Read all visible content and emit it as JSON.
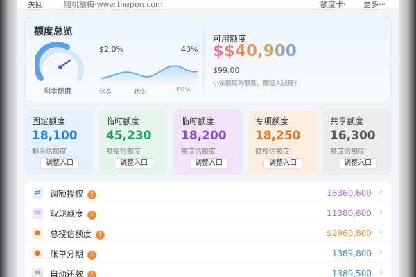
{
  "topbar": {
    "back_label": "关回",
    "site": "随机额梅·www.thepon.com",
    "right1": "额度卡·",
    "right2": "更多···"
  },
  "summary": {
    "title": "额度总览",
    "gauge_label": "剩余额度",
    "rate_left": "$2,0%",
    "rate_right": "40%",
    "axis": [
      "状态",
      "状态",
      "60%"
    ],
    "available": {
      "title": "可用额度",
      "amount": "$$40,900",
      "sub": "$99,00",
      "note": "小余额度刘额度，额提入回度亻"
    }
  },
  "tiles": [
    {
      "title": "固定额度",
      "value": "18,100",
      "sub": "剩余信额度",
      "button": "调整入口",
      "color": "#2b7fd6",
      "bg": "#e6f1fc"
    },
    {
      "title": "临时额度",
      "value": "45,230",
      "sub": "额授信额度",
      "button": "调整入口",
      "color": "#2a9d66",
      "bg": "#e5f5ec"
    },
    {
      "title": "临时额度",
      "value": "18,200",
      "sub": "额度信额度",
      "button": "调整入口",
      "color": "#8a4fc2",
      "bg": "#efe4f8"
    },
    {
      "title": "专项额度",
      "value": "18,250",
      "sub": "额授信额度",
      "button": "调整入口",
      "color": "#e0742a",
      "bg": "#fdeee2"
    },
    {
      "title": "共享额度",
      "value": "16,300",
      "sub": "额度信额度",
      "button": "调整入口",
      "color": "#555555",
      "bg": "#ececec"
    }
  ],
  "list": [
    {
      "icon": "transfer-icon",
      "label": "调额授权",
      "value": "16360,600",
      "color": "#b06ad0",
      "icon_bg": "#e3f0fb",
      "icon_fg": "#3b8ad8",
      "glyph": "⇄"
    },
    {
      "icon": "cash-icon",
      "label": "取现额度",
      "value": "11380,600",
      "color": "#b06ad0",
      "icon_bg": "#f2e4fa",
      "icon_fg": "#9a52c8",
      "glyph": "▭"
    },
    {
      "icon": "user-icon",
      "label": "总授信额度",
      "value": "$2960,800",
      "color": "#e0922a",
      "icon_bg": "#fdecdf",
      "icon_fg": "#e07a2a",
      "glyph": "●"
    },
    {
      "icon": "person-icon",
      "label": "账单分期",
      "value": "1389,800",
      "color": "#3b8ad8",
      "icon_bg": "#fdecdf",
      "icon_fg": "#e07a2a",
      "glyph": "●"
    },
    {
      "icon": "list-icon",
      "label": "自动还款",
      "value": "1389,500",
      "color": "#3b8ad8",
      "icon_bg": "#e8e8e8",
      "icon_fg": "#666666",
      "glyph": "≡"
    }
  ]
}
